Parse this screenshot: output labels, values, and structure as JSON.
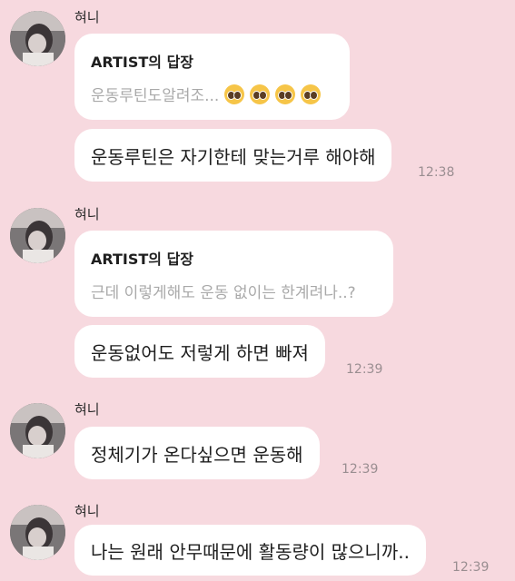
{
  "messages": [
    {
      "sender": "혀니",
      "reply": {
        "title": "ARTIST의 답장",
        "quote": "운동루틴도알려조...",
        "emoji_count": 4
      },
      "text": "운동루틴은 자기한테 맞는거루 해야해",
      "time": "12:38"
    },
    {
      "sender": "혀니",
      "reply": {
        "title": "ARTIST의 답장",
        "quote": "근데 이렇게해도 운동 없이는 한계려나..?"
      },
      "text": "운동없어도 저렇게 하면 빠져",
      "time": "12:39"
    },
    {
      "sender": "혀니",
      "text": "정체기가 온다싶으면 운동해",
      "time": "12:39"
    },
    {
      "sender": "혀니",
      "text": "나는 원래 안무때문에 활동량이 많으니까..",
      "time": "12:39"
    }
  ],
  "emoji_icon": "pleading-face-emoji",
  "colors": {
    "background": "#f7d9df",
    "bubble": "#ffffff",
    "quote_text": "#a9a9a9",
    "timestamp": "#9a8e91"
  }
}
